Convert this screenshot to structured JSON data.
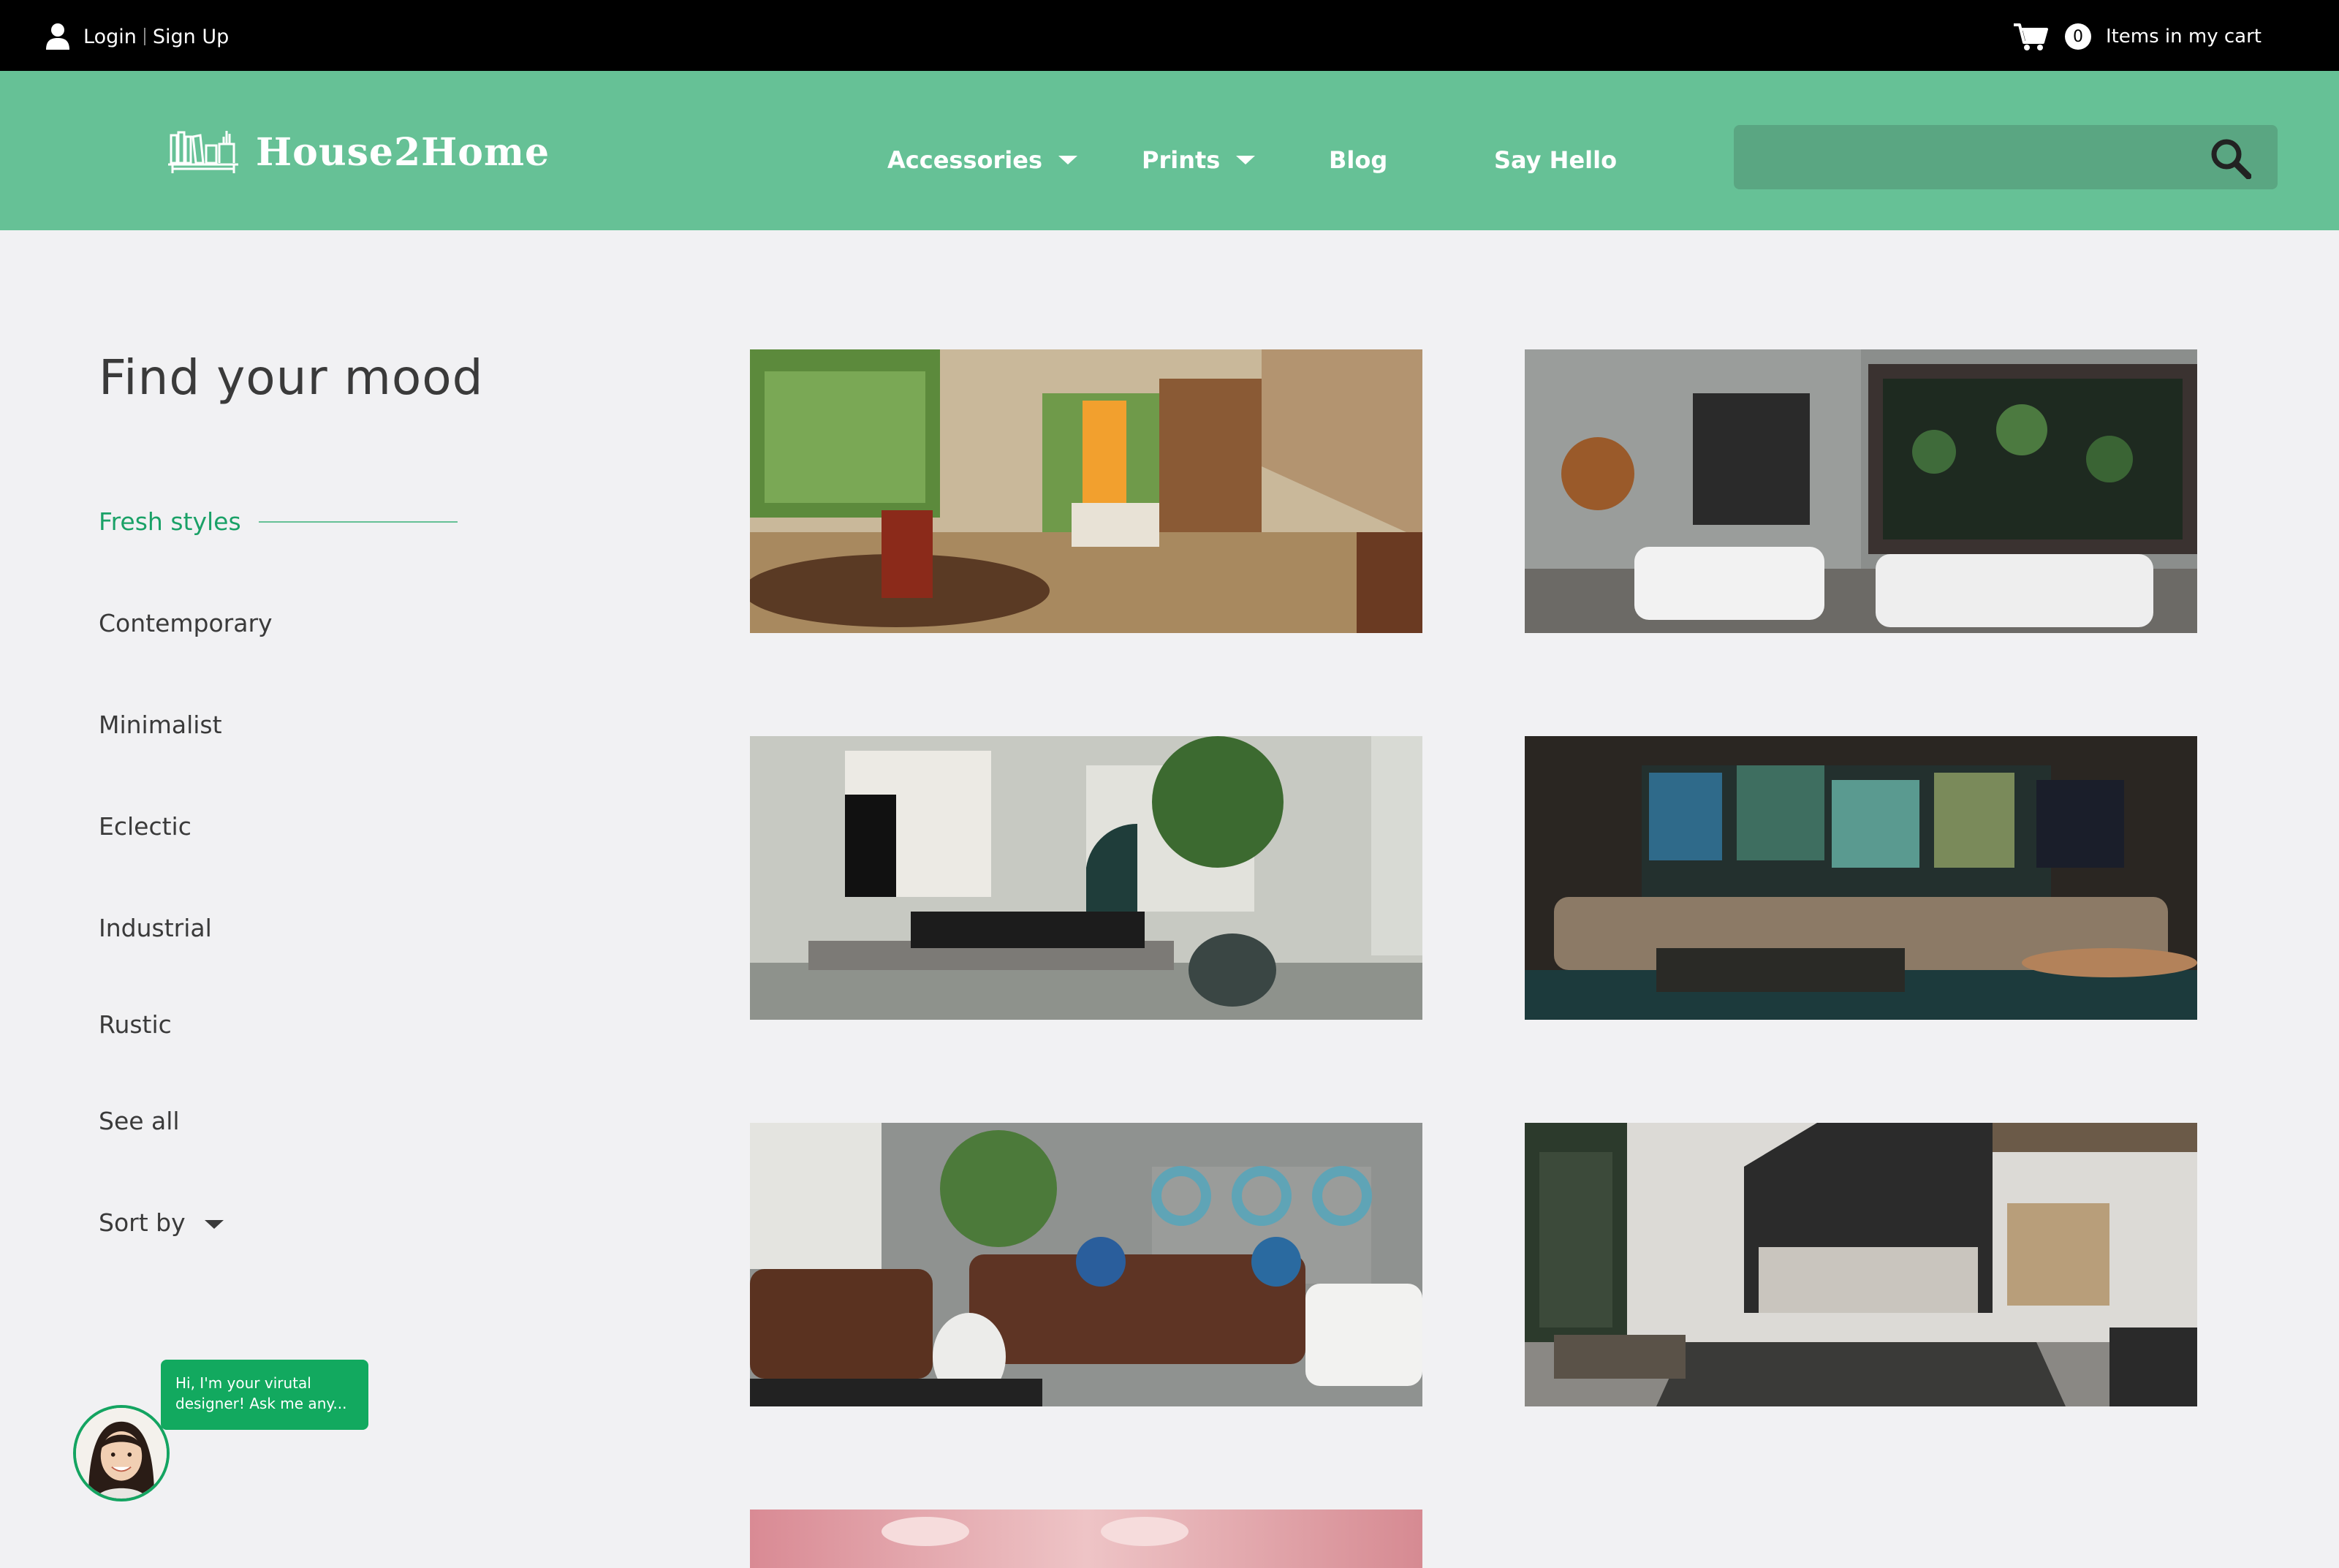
{
  "topbar": {
    "login_label": "Login",
    "signup_label": "Sign Up",
    "cart_count": "0",
    "cart_label": "Items in my cart"
  },
  "header": {
    "logo_text": "House2Home",
    "nav": {
      "accessories": "Accessories",
      "prints": "Prints",
      "blog": "Blog",
      "say_hello": "Say Hello"
    },
    "search_placeholder": ""
  },
  "sidebar": {
    "title": "Find your mood",
    "filters": [
      {
        "label": "Fresh styles",
        "active": true
      },
      {
        "label": "Contemporary"
      },
      {
        "label": "Minimalist"
      },
      {
        "label": "Eclectic"
      },
      {
        "label": "Industrial"
      },
      {
        "label": "Rustic"
      },
      {
        "label": "See all"
      }
    ],
    "sort_label": "Sort by"
  },
  "chat": {
    "message": "Hi, I'm your virutal designer! Ask me any..."
  },
  "colors": {
    "accent": "#66c196",
    "active_text": "#1aa167",
    "chat_bubble": "#12a95f"
  },
  "icons": [
    "user-icon",
    "cart-icon",
    "logo-icon",
    "search-icon",
    "chevron-down-icon"
  ]
}
